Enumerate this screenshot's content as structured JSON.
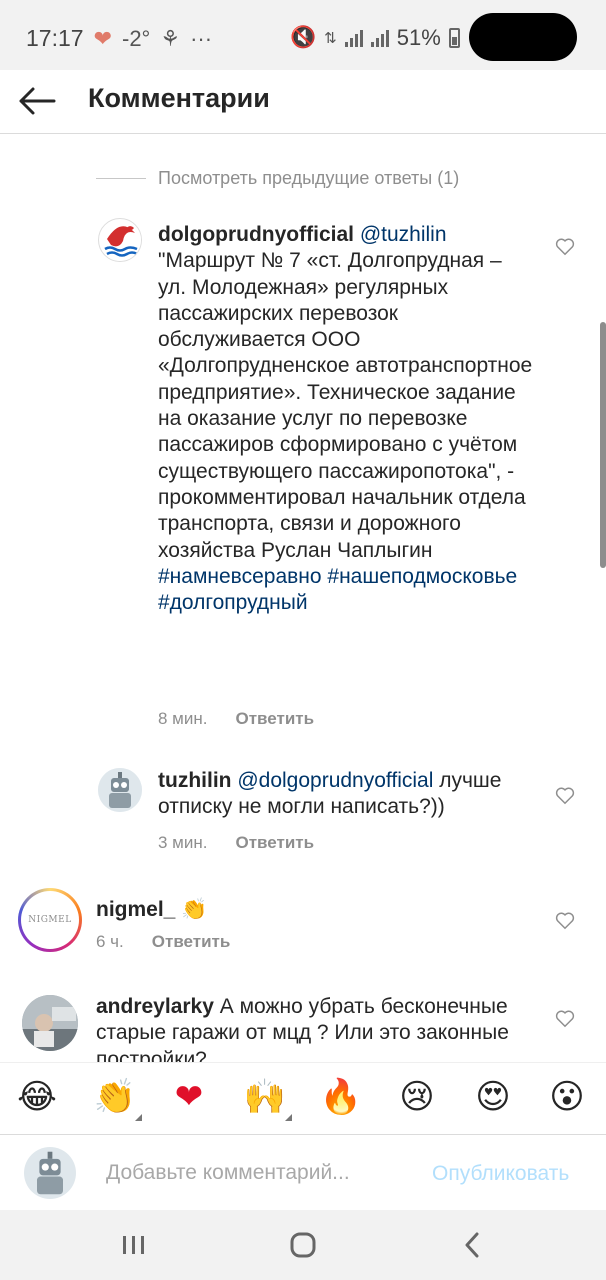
{
  "status": {
    "time": "17:17",
    "temp": "-2°",
    "battery_pct": "51%"
  },
  "header": {
    "title": "Комментарии"
  },
  "prev_replies": "Посмотреть предыдущие ответы (1)",
  "comments": [
    {
      "user": "dolgoprudnyofficial",
      "mention": "@tuzhilin",
      "text": "\"Маршрут № 7 «ст. Долгопрудная – ул. Молодежная» регулярных пассажирских перевозок обслуживается ООО «Долгопрудненское автотранспортное предприятие». Техническое задание на оказание услуг по перевозке пассажиров сформировано с учётом существующего пассажиропотока\", - прокомментировал начальник отдела транспорта, связи и дорожного хозяйства Руслан Чаплыгин",
      "hashtags": [
        "#намневсеравно",
        "#нашеподмосковье",
        "#долгопрудный"
      ],
      "time": "8 мин.",
      "reply_label": "Ответить"
    },
    {
      "user": "tuzhilin",
      "mention": "@dolgoprudnyofficial",
      "text": "лучше отписку не могли написать?))",
      "time": "3 мин.",
      "reply_label": "Ответить"
    },
    {
      "user": "nigmel_",
      "text": "👏",
      "time": "6 ч.",
      "reply_label": "Ответить",
      "avatar_text": "NIGMEL"
    },
    {
      "user": "andreylarky",
      "text": "А можно убрать бесконечные старые гаражи от мцд ? Или это законные постройки?"
    }
  ],
  "emojis": [
    "😂",
    "👏",
    "❤",
    "🙌",
    "🔥",
    "😢",
    "😍",
    "😮"
  ],
  "input": {
    "placeholder": "Добавьте комментарий...",
    "publish_label": "Опубликовать"
  },
  "colors": {
    "link": "#003569",
    "muted": "#8e8e8e",
    "publish": "#b2dffc"
  }
}
